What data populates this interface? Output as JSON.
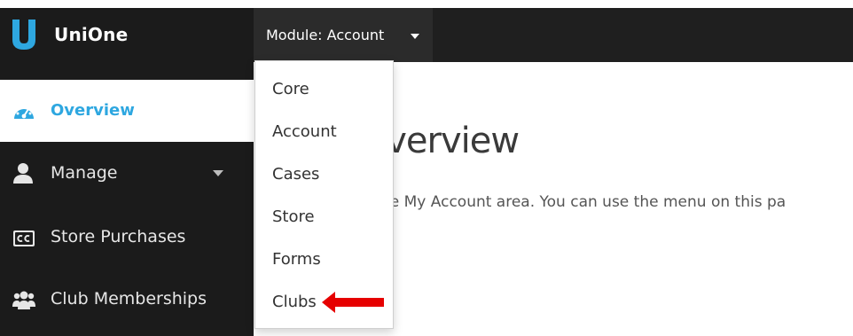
{
  "brand": {
    "name": "UniOne"
  },
  "topbar": {
    "module_label": "Module: Account"
  },
  "sidebar": {
    "items": [
      {
        "label": "Overview",
        "icon": "dashboard-icon",
        "active": true
      },
      {
        "label": "Manage",
        "icon": "user-icon"
      },
      {
        "label": "Store Purchases",
        "icon": "cc-icon"
      },
      {
        "label": "Club Memberships",
        "icon": "users-icon"
      }
    ]
  },
  "main": {
    "title": "nt Overview",
    "intro": "he My Account area. You can use the menu on this pa"
  },
  "module_menu": {
    "items": [
      "Core",
      "Account",
      "Cases",
      "Store",
      "Forms",
      "Clubs"
    ]
  },
  "colors": {
    "accent": "#2ea7e0",
    "arrow": "#e60000"
  }
}
